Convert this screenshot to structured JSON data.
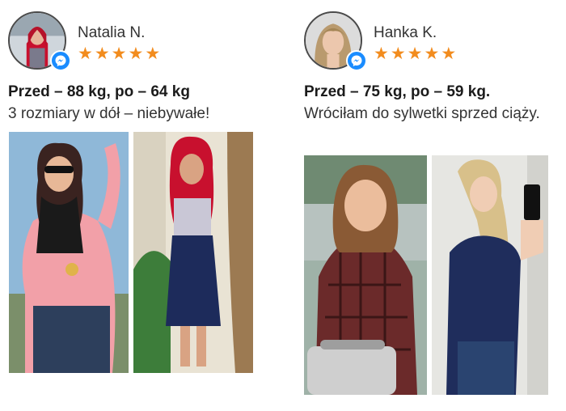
{
  "testimonials": [
    {
      "name": "Natalia N.",
      "rating": 5,
      "stars": "★★★★★",
      "weight_line": "Przed – 88 kg, po – 64 kg",
      "quote": "3 rozmiary w dół – niebywałe!",
      "badge_icon": "messenger-icon"
    },
    {
      "name": "Hanka K.",
      "rating": 5,
      "stars": "★★★★★",
      "weight_line": "Przed – 75 kg, po – 59 kg.",
      "quote": "Wróciłam do sylwetki sprzed ciąży.",
      "badge_icon": "messenger-icon"
    }
  ],
  "colors": {
    "star": "#f28c1e",
    "messenger_badge": "#1a8cff"
  }
}
